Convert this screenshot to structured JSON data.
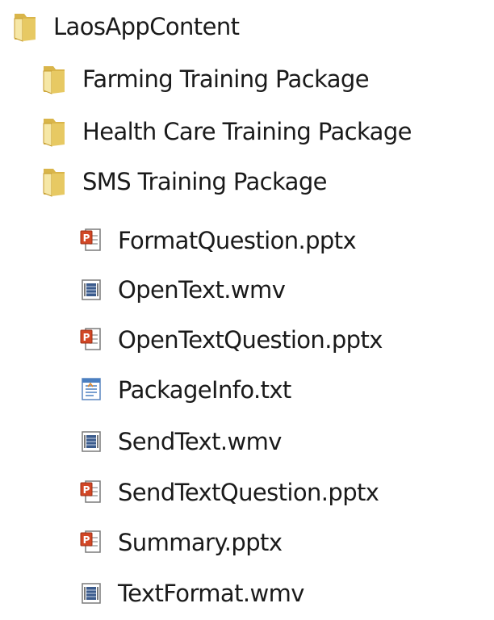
{
  "tree": {
    "root": {
      "label": "LaosAppContent",
      "icon": "folder-icon"
    },
    "folders": [
      {
        "label": "Farming Training Package",
        "icon": "folder-icon"
      },
      {
        "label": "Health Care Training Package",
        "icon": "folder-icon"
      },
      {
        "label": "SMS Training Package",
        "icon": "folder-icon"
      }
    ],
    "files": [
      {
        "label": "FormatQuestion.pptx",
        "icon": "powerpoint-file-icon"
      },
      {
        "label": "OpenText.wmv",
        "icon": "video-file-icon"
      },
      {
        "label": "OpenTextQuestion.pptx",
        "icon": "powerpoint-file-icon"
      },
      {
        "label": "PackageInfo.txt",
        "icon": "text-file-icon"
      },
      {
        "label": "SendText.wmv",
        "icon": "video-file-icon"
      },
      {
        "label": "SendTextQuestion.pptx",
        "icon": "powerpoint-file-icon"
      },
      {
        "label": "Summary.pptx",
        "icon": "powerpoint-file-icon"
      },
      {
        "label": "TextFormat.wmv",
        "icon": "video-file-icon"
      }
    ]
  },
  "colors": {
    "folder_light": "#f6e7a6",
    "folder_dark": "#d9b54a",
    "ppt_red": "#d24726",
    "video_blue": "#3b5b8c",
    "text_blue": "#4a7fc1"
  }
}
